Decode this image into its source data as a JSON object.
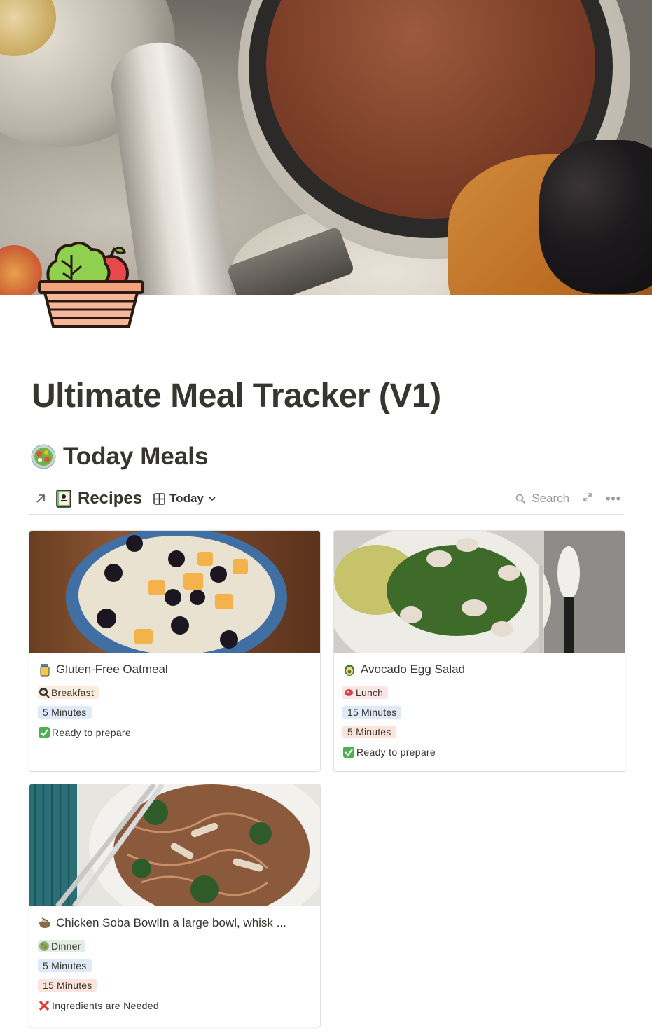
{
  "page": {
    "title": "Ultimate Meal Tracker (V1)"
  },
  "section": {
    "heading": "Today Meals"
  },
  "database": {
    "title": "Recipes",
    "view": "Today",
    "search_label": "Search"
  },
  "cards": [
    {
      "title": "Gluten-Free Oatmeal",
      "meal": "Breakfast",
      "meal_color": "#fbecdd",
      "times": [
        {
          "label": "5 Minutes",
          "color": "#dfe9f7"
        }
      ],
      "status": "Ready to prepare",
      "status_icon": "check-icon"
    },
    {
      "title": "Avocado Egg Salad",
      "meal": "Lunch",
      "meal_color": "#fbe4e4",
      "times": [
        {
          "label": "15 Minutes",
          "color": "#dfe9f7"
        },
        {
          "label": "5 Minutes",
          "color": "#fbe4dc"
        }
      ],
      "status": "Ready to prepare",
      "status_icon": "check-icon"
    },
    {
      "title": "Chicken Soba BowlIn a large bowl, whisk ...",
      "meal": "Dinner",
      "meal_color": "#e3ede4",
      "times": [
        {
          "label": "5 Minutes",
          "color": "#dfe9f7"
        },
        {
          "label": "15 Minutes",
          "color": "#fbe4dc"
        }
      ],
      "status": "Ingredients are Needed",
      "status_icon": "cross-icon"
    }
  ],
  "colors": {
    "text": "#37352f",
    "muted": "#9b9a97",
    "divider": "#dedddb"
  }
}
